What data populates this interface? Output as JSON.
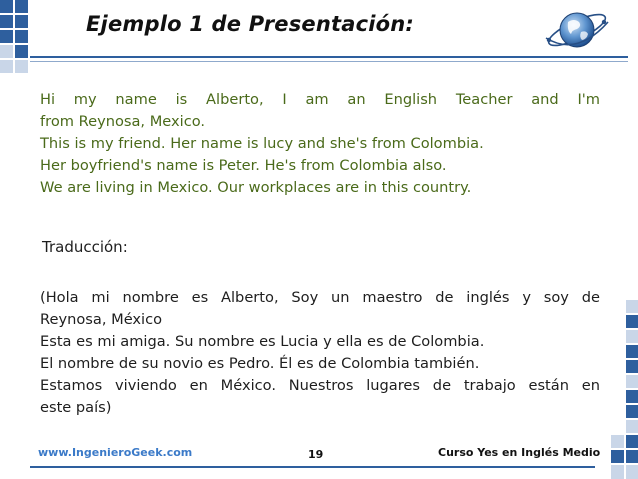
{
  "slide": {
    "title": "Ejemplo 1 de Presentación:",
    "paragraph_english": [
      "Hi my name is Alberto, I am an English Teacher and I'm",
      "from Reynosa, Mexico.",
      "This is my friend. Her name is lucy and she's from Colombia.",
      "Her boyfriend's name is Peter. He's from Colombia also.",
      "We are living in Mexico. Our workplaces are in this country."
    ],
    "translation_heading": "Traducción:",
    "paragraph_spanish": [
      "(Hola mi nombre es Alberto, Soy un maestro de inglés y soy de",
      "Reynosa, México",
      "Esta es mi amiga. Su nombre es Lucia y ella es de Colombia.",
      "El nombre de su novio es Pedro. Él es de Colombia también.",
      "Estamos viviendo en México. Nuestros lugares de trabajo están en",
      "este país)"
    ],
    "footer": {
      "website": "www.IngenieroGeek.com",
      "page_number": "19",
      "course": "Curso Yes en Inglés Medio"
    }
  },
  "colors": {
    "accent_blue": "#2e5f9e",
    "english_text": "#4a6a1a",
    "link_blue": "#3b7ac8"
  },
  "icons": [
    "globe-logo-icon"
  ]
}
